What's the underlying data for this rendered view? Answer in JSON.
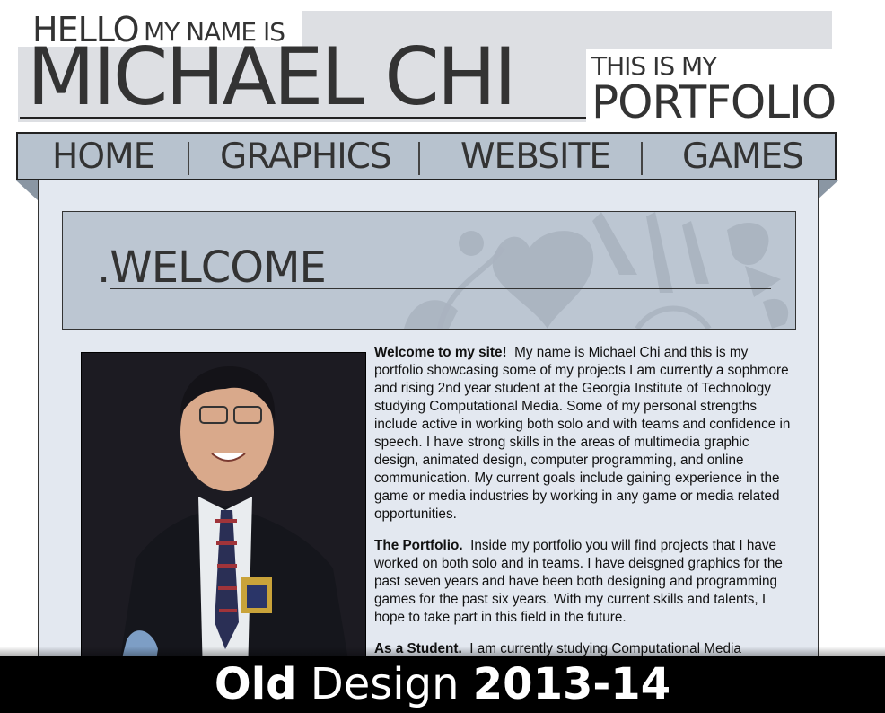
{
  "header": {
    "hello": "HELLO",
    "my_name_is": "MY NAME IS",
    "name": "MICHAEL CHI",
    "this_is_my": "THIS IS MY",
    "portfolio": "PORTFOLIO"
  },
  "nav": {
    "items": [
      {
        "label": "HOME"
      },
      {
        "label": "GRAPHICS"
      },
      {
        "label": "WEBSITE"
      },
      {
        "label": "GAMES"
      }
    ]
  },
  "content": {
    "welcome_title": ".WELCOME",
    "paragraphs": [
      {
        "lead": "Welcome to my site!",
        "body": "My name is Michael Chi and this is my portfolio showcasing some of my projects I am currently a sophmore and rising 2nd year student at the Georgia Institute of Technology studying Computational Media. Some of my personal strengths include active in working both solo and with teams and confidence in speech. I have strong skills in the areas of multimedia graphic design, animated design, computer programming, and online communication. My current goals include gaining experience in the game or media industries by working in any game or media related opportunities."
      },
      {
        "lead": "The Portfolio.",
        "body": "Inside my portfolio you will find projects that I have worked on both solo and in teams. I have deisgned graphics for the past seven years and have been both designing and programming games for the past six years. With my current skills and talents, I hope to take part in this field in the future."
      },
      {
        "lead": "As a Student.",
        "body": "I am currently studying Computational Media"
      }
    ]
  },
  "caption": {
    "word1": "Old",
    "word2": "Design",
    "word3": "2013-14"
  },
  "colors": {
    "header_band": "#dddfe3",
    "nav_bg": "#b7c2ce",
    "content_bg": "#e3e8f0",
    "welcome_bg": "#bcc6d2",
    "caption_bg": "#000000"
  }
}
